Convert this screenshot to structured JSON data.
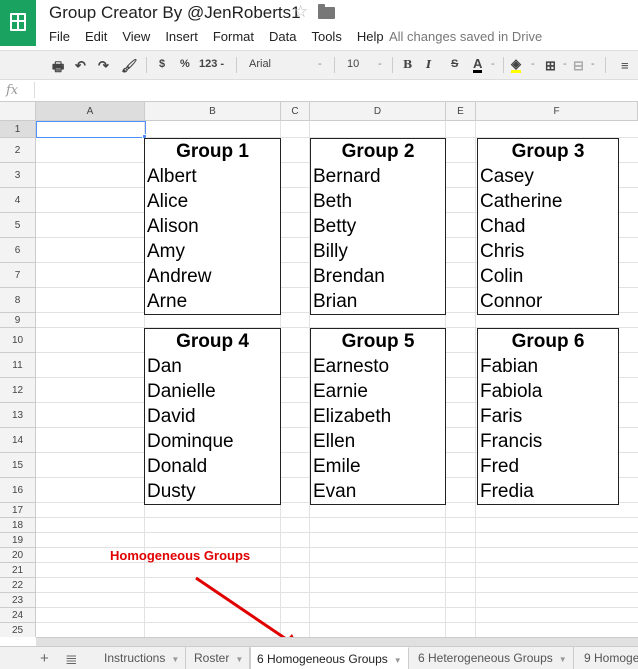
{
  "app": {
    "title": "Group Creator By @JenRoberts1",
    "save_status": "All changes saved in Drive"
  },
  "menu": [
    "File",
    "Edit",
    "View",
    "Insert",
    "Format",
    "Data",
    "Tools",
    "Help"
  ],
  "toolbar": {
    "currency": "$",
    "percent": "%",
    "number_format": "123 -",
    "font": "Arial",
    "font_size": "10",
    "bold": "B",
    "italic": "I",
    "strike": "S",
    "text_color": "A"
  },
  "formula_bar": {
    "fx": "fx",
    "value": ""
  },
  "columns": [
    "A",
    "B",
    "C",
    "D",
    "E",
    "F"
  ],
  "rows": [
    "1",
    "2",
    "3",
    "4",
    "5",
    "6",
    "7",
    "8",
    "9",
    "10",
    "11",
    "12",
    "13",
    "14",
    "15",
    "16",
    "17",
    "18",
    "19",
    "20",
    "21",
    "22",
    "23",
    "24",
    "25"
  ],
  "groups": [
    {
      "title": "Group 1",
      "names": [
        "Albert",
        "Alice",
        "Alison",
        "Amy",
        "Andrew",
        "Arne"
      ]
    },
    {
      "title": "Group 2",
      "names": [
        "Bernard",
        "Beth",
        "Betty",
        "Billy",
        "Brendan",
        "Brian"
      ]
    },
    {
      "title": "Group 3",
      "names": [
        "Casey",
        "Catherine",
        "Chad",
        "Chris",
        "Colin",
        "Connor"
      ]
    },
    {
      "title": "Group 4",
      "names": [
        "Dan",
        "Danielle",
        "David",
        "Dominque",
        "Donald",
        "Dusty"
      ]
    },
    {
      "title": "Group 5",
      "names": [
        "Earnesto",
        "Earnie",
        "Elizabeth",
        "Ellen",
        "Emile",
        "Evan"
      ]
    },
    {
      "title": "Group 6",
      "names": [
        "Fabian",
        "Fabiola",
        "Faris",
        "Francis",
        "Fred",
        "Fredia"
      ]
    }
  ],
  "annotation": {
    "text": "Homogeneous Groups",
    "color": "#e00000"
  },
  "sheet_tabs": [
    {
      "label": "Instructions",
      "active": false
    },
    {
      "label": "Roster",
      "active": false
    },
    {
      "label": "6 Homogeneous Groups",
      "active": true
    },
    {
      "label": "6 Heterogeneous Groups",
      "active": false
    },
    {
      "label": "9 Homoge",
      "active": false
    }
  ],
  "colors": {
    "accent": "#1aa260",
    "selection": "#4d90fe"
  }
}
